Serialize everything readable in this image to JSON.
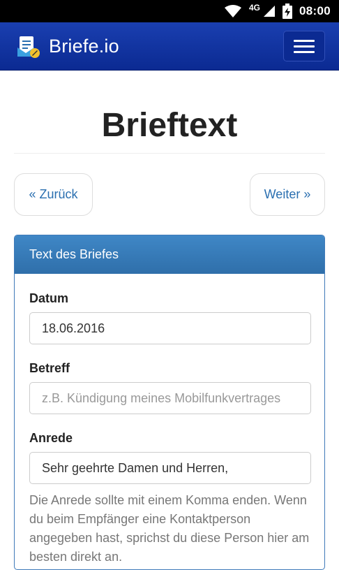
{
  "status_bar": {
    "network": "4G",
    "time": "08:00"
  },
  "navbar": {
    "brand": "Briefe.io",
    "menu_icon": "hamburger-menu-icon"
  },
  "page": {
    "title": "Brieftext"
  },
  "pager": {
    "back_label": "« Zurück",
    "next_label": "Weiter »"
  },
  "panel": {
    "heading": "Text des Briefes",
    "fields": {
      "datum": {
        "label": "Datum",
        "value": "18.06.2016"
      },
      "betreff": {
        "label": "Betreff",
        "value": "",
        "placeholder": "z.B. Kündigung meines Mobilfunkvertrages"
      },
      "anrede": {
        "label": "Anrede",
        "value": "Sehr geehrte Damen und Herren,"
      }
    },
    "anrede_help": "Die Anrede sollte mit einem Komma enden. Wenn du beim Empfänger eine Kontaktperson angegeben hast, sprichst du diese Person hier am besten direkt an."
  },
  "colors": {
    "navbar": "#0b2a92",
    "panel_heading": "#3579b8",
    "link": "#2a6fb0"
  }
}
